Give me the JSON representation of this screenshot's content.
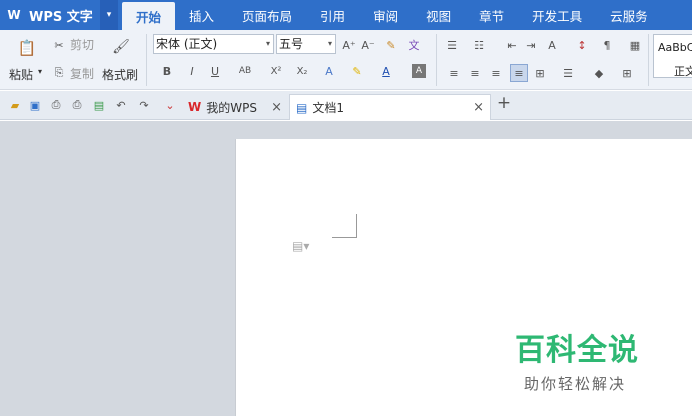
{
  "app": {
    "name": "WPS 文字",
    "logo_glyph": "W"
  },
  "tabs": [
    "开始",
    "插入",
    "页面布局",
    "引用",
    "审阅",
    "视图",
    "章节",
    "开发工具",
    "云服务"
  ],
  "ribbon": {
    "clipboard": {
      "paste": "粘贴",
      "cut": "剪切",
      "copy": "复制",
      "format_painter": "格式刷"
    },
    "font": {
      "name": "宋体 (正文)",
      "size": "五号"
    },
    "style_preview": {
      "sample": "AaBbC",
      "name": "正文"
    }
  },
  "doc_tabs": [
    {
      "label": "我的WPS",
      "icon": "wps-logo-icon"
    },
    {
      "label": "文档1",
      "icon": "document-icon"
    }
  ],
  "watermark": {
    "title": "百科全说",
    "subtitle": "助你轻松解决"
  },
  "colors": {
    "brand": "#2f6fc9",
    "ribbon_bg": "#eef2f8",
    "watermark_green": "#2eb873"
  }
}
